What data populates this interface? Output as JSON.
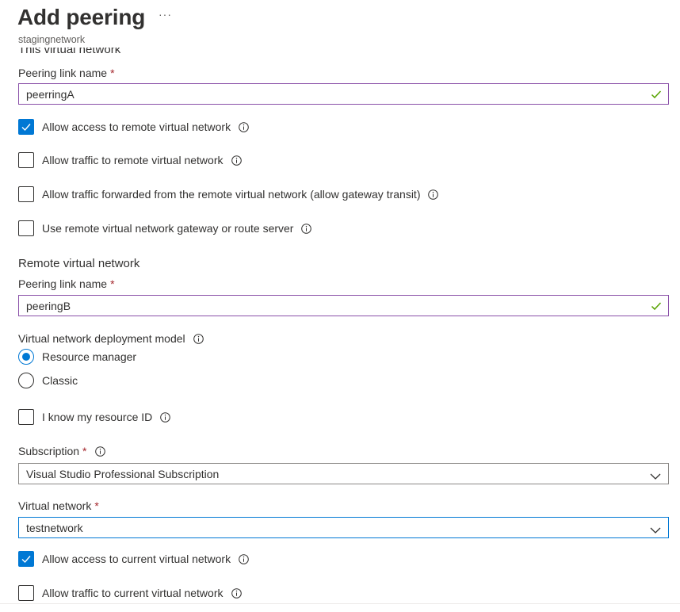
{
  "header": {
    "title": "Add peering",
    "more_label": "···",
    "subtitle": "stagingnetwork"
  },
  "this_network": {
    "section_title": "This virtual network",
    "link_name_label": "Peering link name",
    "link_name_value": "peerringA",
    "options": [
      {
        "label": "Allow access to remote virtual network",
        "checked": true
      },
      {
        "label": "Allow traffic to remote virtual network",
        "checked": false
      },
      {
        "label": "Allow traffic forwarded from the remote virtual network (allow gateway transit)",
        "checked": false
      },
      {
        "label": "Use remote virtual network gateway or route server",
        "checked": false
      }
    ]
  },
  "remote_network": {
    "section_title": "Remote virtual network",
    "link_name_label": "Peering link name",
    "link_name_value": "peeringB",
    "deployment_model_label": "Virtual network deployment model",
    "deployment_models": [
      {
        "label": "Resource manager",
        "selected": true
      },
      {
        "label": "Classic",
        "selected": false
      }
    ],
    "know_resource_id_label": "I know my resource ID",
    "know_resource_id_checked": false,
    "subscription_label": "Subscription",
    "subscription_value": "Visual Studio Professional Subscription",
    "virtual_network_label": "Virtual network",
    "virtual_network_value": "testnetwork",
    "options": [
      {
        "label": "Allow access to current virtual network",
        "checked": true
      },
      {
        "label": "Allow traffic to current virtual network",
        "checked": false
      }
    ]
  },
  "required_marker": "*",
  "icons": {
    "info": "info-icon",
    "valid": "checkmark-icon",
    "dropdown": "chevron-down-icon",
    "check": "checkmark-icon"
  },
  "colors": {
    "accent": "#0078d4",
    "required": "#a4262c",
    "valid_check": "#57a300",
    "field_border": "#8a50a8"
  }
}
